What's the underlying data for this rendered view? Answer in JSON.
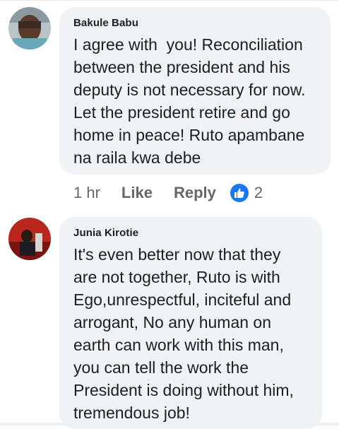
{
  "comments": [
    {
      "author": "Bakule Babu",
      "text": "I agree with  you! Reconciliation\nbetween the president and his\ndeputy is not necessary for now.\nLet the president retire and go\nhome in peace! Ruto apambane\nna raila kwa debe",
      "time": "1 hr",
      "like_label": "Like",
      "reply_label": "Reply",
      "reaction_count": "2",
      "reaction_icon": "like-thumb-icon"
    },
    {
      "author": "Junia Kirotie",
      "text": "It's even better now that they\nare not together, Ruto is with\nEgo,unrespectful, inciteful and\narrogant, No any human on\nearth can work with this man,\nyou can tell the work the\nPresident is doing without him,\ntremendous job!"
    }
  ],
  "colors": {
    "bubble": "#f0f2f5",
    "text": "#1c1e21",
    "secondary_text": "#65676b",
    "like_blue": "#1877f2"
  }
}
